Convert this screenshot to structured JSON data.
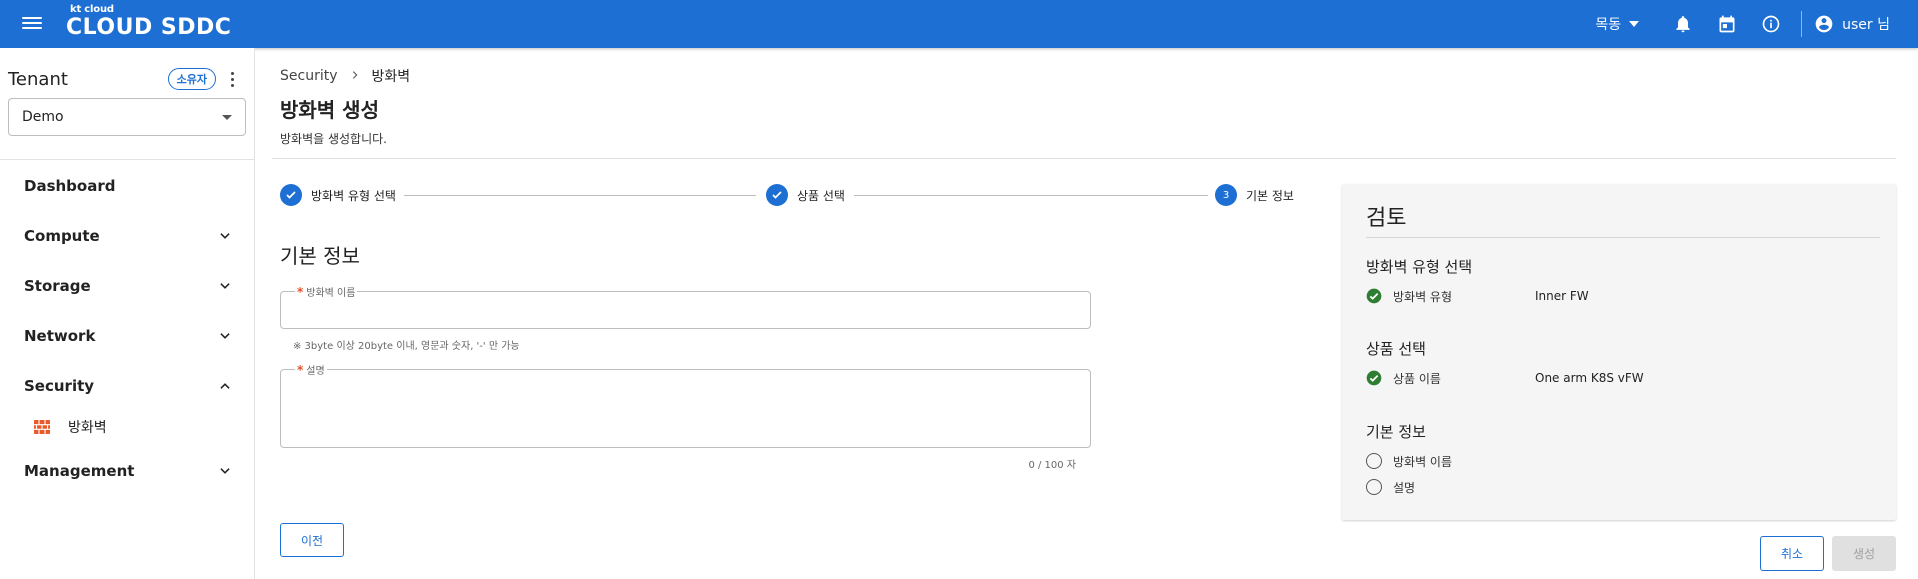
{
  "header": {
    "logo_small": "kt cloud",
    "logo_main": "CLOUD SDDC",
    "region": "목동",
    "user_name": "user 님"
  },
  "sidebar": {
    "tenant_title": "Tenant",
    "owner_chip": "소유자",
    "tenant_selected": "Demo",
    "items": [
      {
        "label": "Dashboard"
      },
      {
        "label": "Compute"
      },
      {
        "label": "Storage"
      },
      {
        "label": "Network"
      },
      {
        "label": "Security"
      },
      {
        "label": "Management"
      }
    ],
    "security_sub": "방화벽"
  },
  "breadcrumb": {
    "root": "Security",
    "current": "방화벽"
  },
  "page": {
    "title": "방화벽 생성",
    "description": "방화벽을 생성합니다."
  },
  "stepper": {
    "steps": [
      {
        "label": "방화벽 유형 선택",
        "state": "done"
      },
      {
        "label": "상품 선택",
        "state": "done"
      },
      {
        "label": "기본 정보",
        "state": "active",
        "number": "3"
      }
    ]
  },
  "form": {
    "section_title": "기본 정보",
    "name_label": "방화벽 이름",
    "name_value": "",
    "name_hint": "※ 3byte 이상 20byte 이내, 영문과 숫자, '-' 만 가능",
    "desc_label": "설명",
    "desc_value": "",
    "desc_counter": "0 / 100 자",
    "prev_button": "이전"
  },
  "review": {
    "title": "검토",
    "sections": [
      {
        "title": "방화벽 유형 선택",
        "rows": [
          {
            "key": "방화벽 유형",
            "value": "Inner FW",
            "status": "complete"
          }
        ]
      },
      {
        "title": "상품 선택",
        "rows": [
          {
            "key": "상품 이름",
            "value": "One arm K8S vFW",
            "status": "complete"
          }
        ]
      },
      {
        "title": "기본 정보",
        "rows": [
          {
            "key": "방화벽 이름",
            "value": "",
            "status": "empty"
          },
          {
            "key": "설명",
            "value": "",
            "status": "empty"
          }
        ]
      }
    ]
  },
  "actions": {
    "cancel": "취소",
    "create": "생성"
  },
  "colors": {
    "primary": "#1d6fd3",
    "success": "#2e7d32",
    "required": "#e5502a",
    "firewall_icon": "#e85a2a"
  }
}
